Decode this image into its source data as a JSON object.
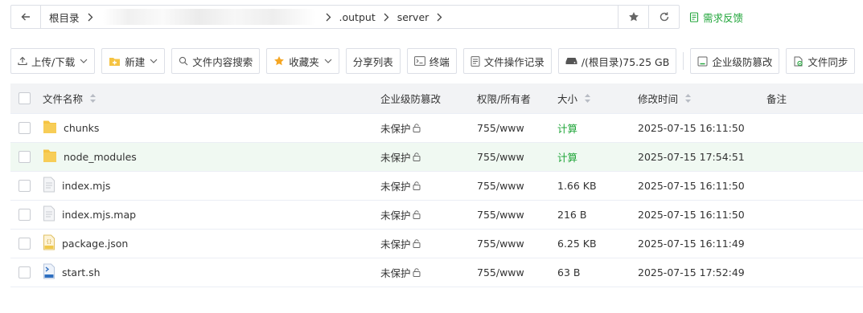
{
  "pathbar": {
    "crumbs_before": [
      "根目录"
    ],
    "crumbs_after": [
      ".output",
      "server"
    ]
  },
  "feedback": {
    "label": "需求反馈"
  },
  "toolbar": {
    "upload_label": "上传/下载",
    "new_label": "新建",
    "search_label": "文件内容搜索",
    "favorites_label": "收藏夹",
    "share_label": "分享列表",
    "terminal_label": "终端",
    "oplog_label": "文件操作记录",
    "disk_label": "/(根目录)75.25 GB",
    "tamper_label": "企业级防篡改",
    "sync_label": "文件同步"
  },
  "table": {
    "headers": {
      "name": "文件名称",
      "protect": "企业级防篡改",
      "perm": "权限/所有者",
      "size": "大小",
      "mtime": "修改时间",
      "note": "备注"
    },
    "rows": [
      {
        "name": "chunks",
        "icon": "folder",
        "protect": "未保护",
        "perm": "755/www",
        "size": "计算",
        "mtime": "2025-07-15 16:11:50"
      },
      {
        "name": "node_modules",
        "icon": "folder",
        "protect": "未保护",
        "perm": "755/www",
        "size": "计算",
        "mtime": "2025-07-15 17:54:51"
      },
      {
        "name": "index.mjs",
        "icon": "file",
        "protect": "未保护",
        "perm": "755/www",
        "size": "1.66 KB",
        "mtime": "2025-07-15 16:11:50"
      },
      {
        "name": "index.mjs.map",
        "icon": "file",
        "protect": "未保护",
        "perm": "755/www",
        "size": "216 B",
        "mtime": "2025-07-15 16:11:50"
      },
      {
        "name": "package.json",
        "icon": "json",
        "protect": "未保护",
        "perm": "755/www",
        "size": "6.25 KB",
        "mtime": "2025-07-15 16:11:49"
      },
      {
        "name": "start.sh",
        "icon": "shell",
        "protect": "未保护",
        "perm": "755/www",
        "size": "63 B",
        "mtime": "2025-07-15 17:52:49"
      }
    ]
  },
  "colors": {
    "accent": "#20a53a",
    "folder": "#f5c342",
    "header_bg": "#f2f3f5",
    "hover_row": "#f0f9f2"
  }
}
